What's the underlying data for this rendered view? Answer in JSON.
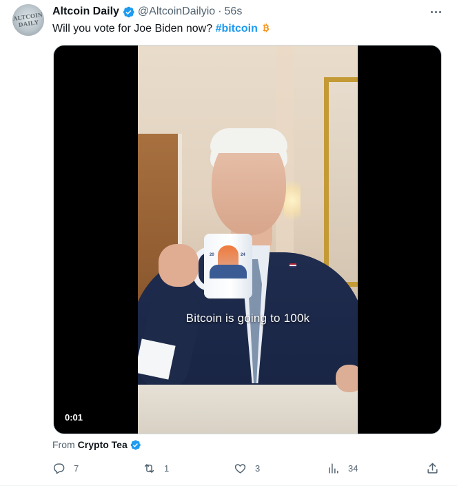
{
  "tweet": {
    "author_name": "Altcoin Daily",
    "handle": "@AltcoinDailyio",
    "separator": "·",
    "time": "56s",
    "avatar_text": "ALTCOIN DAILY",
    "text_before": "Will you vote for Joe Biden now? ",
    "hashtag": "#bitcoin",
    "emoji": "bitcoin-icon"
  },
  "video": {
    "caption": "Bitcoin is going to 100k",
    "timestamp": "0:01",
    "mug_year_left": "20",
    "mug_year_right": "24"
  },
  "source": {
    "prefix": "From",
    "name": "Crypto Tea"
  },
  "actions": {
    "replies": "7",
    "reposts": "1",
    "likes": "3",
    "views": "34"
  },
  "colors": {
    "accent": "#1d9bf0",
    "text": "#0f1419",
    "secondary": "#536471",
    "bitcoin": "#f7931a"
  }
}
